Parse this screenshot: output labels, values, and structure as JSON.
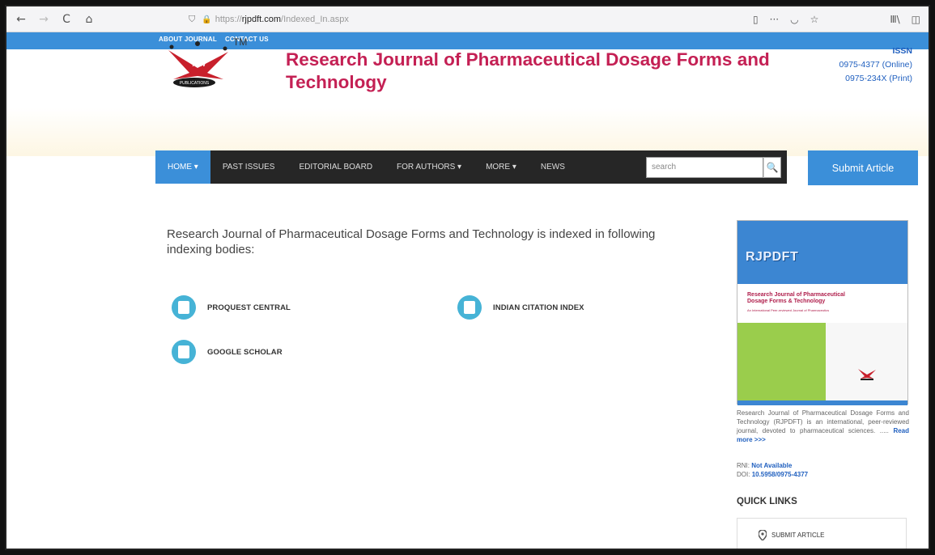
{
  "browser": {
    "back_icon": "←",
    "forward_icon": "→",
    "reload_icon": "C",
    "home_icon": "⌂",
    "shield_icon": "⛉",
    "lock_icon": "🔒",
    "url_prefix": "https://",
    "url_domain": "rjpdft.com",
    "url_path": "/Indexed_In.aspx",
    "reader_icon": "▯",
    "more_icon": "···",
    "pocket_icon": "◡",
    "bookmark_icon": "☆",
    "library_icon": "Ⅲ\\",
    "sidebar_icon": "◫"
  },
  "top_links": [
    "ABOUT JOURNAL",
    "CONTACT US"
  ],
  "header": {
    "tm": "TM",
    "title": "Research Journal of Pharmaceutical Dosage Forms and Technology",
    "issn_label": "ISSN",
    "issn_online": "0975-4377 (Online)",
    "issn_print": "0975-234X (Print)",
    "logo_text": "A&V",
    "logo_sub": "PUBLICATIONS"
  },
  "nav": {
    "items": [
      "HOME ▾",
      "PAST ISSUES",
      "EDITORIAL BOARD",
      "FOR AUTHORS ▾",
      "MORE ▾",
      "NEWS"
    ],
    "search_placeholder": "search",
    "search_icon": "🔍",
    "submit_label": "Submit Article"
  },
  "main": {
    "heading": "Research Journal of Pharmaceutical Dosage Forms and Technology is indexed in following indexing bodies:",
    "indexes": [
      "PROQUEST CENTRAL",
      "INDIAN CITATION INDEX",
      "GOOGLE SCHOLAR"
    ]
  },
  "sidebar": {
    "cover_brand": "RJPDFT",
    "cover_title_1": "Research Journal of Pharmaceutical",
    "cover_title_2": "Dosage Forms & Technology",
    "cover_sub": "An International Peer-reviewed Journal of Pharmaceutics",
    "about": "Research Journal of Pharmaceutical Dosage Forms and Technology (RJPDFT) is an international, peer-reviewed journal, devoted to pharmaceutical sciences. .....",
    "read_more": "Read more >>>",
    "rni_label": "RNI:",
    "rni_value": "Not Available",
    "doi_label": "DOI:",
    "doi_value": "10.5958/0975-4377",
    "quick_links_title": "QUICK LINKS",
    "quick_links": [
      "SUBMIT ARTICLE"
    ]
  },
  "colors": {
    "accent_blue": "#3b8fd9",
    "title_red": "#c42054",
    "nav_dark": "#262626",
    "index_icon_teal": "#46b3d6"
  }
}
